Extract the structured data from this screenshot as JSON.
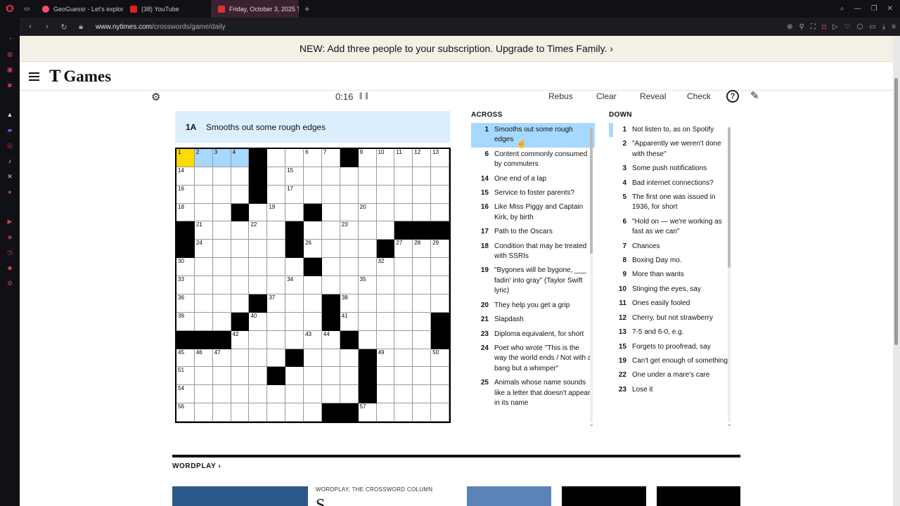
{
  "browser": {
    "tabs": [
      {
        "label": "GeoGuessr - Let's explore",
        "fav_color": "#ff4d6d"
      },
      {
        "label": "(38) YouTube",
        "fav_color": "#e62117"
      },
      {
        "label": "Friday, October 3, 2025 T",
        "fav_color": "#d33"
      }
    ],
    "url_host": "www.nytimes.com",
    "url_path": "/crosswords/game/daily"
  },
  "promo": {
    "text": "NEW: Add three people to your subscription. Upgrade to Times Family. ›"
  },
  "header": {
    "logo_t": "T",
    "logo_games": "Games"
  },
  "toolbar": {
    "timer": "0:16",
    "pause": "❚❚",
    "rebus": "Rebus",
    "clear": "Clear",
    "reveal": "Reveal",
    "check": "Check",
    "help": "?"
  },
  "current_clue": {
    "number": "1A",
    "text": "Smooths out some rough edges"
  },
  "grid": {
    "rows": [
      "....#....#.....",
      "....#..........",
      "....#..........",
      "...#...#.......",
      "#.....#.....###",
      "#.....#....#...",
      ".......#.......",
      "...............",
      "....#...#......",
      "...#....#.....#",
      "###......#....#",
      "......#...#....",
      ".....#....#....",
      "..........#....",
      "........##....."
    ],
    "numbers": [
      [
        0,
        0,
        1
      ],
      [
        0,
        1,
        2
      ],
      [
        0,
        2,
        3
      ],
      [
        0,
        3,
        4
      ],
      [
        0,
        4,
        5
      ],
      [
        0,
        7,
        6
      ],
      [
        0,
        8,
        7
      ],
      [
        0,
        9,
        8
      ],
      [
        0,
        10,
        9
      ],
      [
        0,
        11,
        10
      ],
      [
        0,
        12,
        11
      ],
      [
        0,
        13,
        12
      ],
      [
        0,
        14,
        13
      ],
      [
        1,
        0,
        14
      ],
      [
        1,
        6,
        15
      ],
      [
        2,
        0,
        16
      ],
      [
        2,
        6,
        17
      ],
      [
        3,
        0,
        18
      ],
      [
        3,
        5,
        19
      ],
      [
        3,
        10,
        20
      ],
      [
        4,
        1,
        21
      ],
      [
        4,
        4,
        22
      ],
      [
        4,
        9,
        23
      ],
      [
        5,
        1,
        24
      ],
      [
        5,
        6,
        25
      ],
      [
        5,
        7,
        26
      ],
      [
        5,
        12,
        27
      ],
      [
        5,
        13,
        28
      ],
      [
        5,
        14,
        29
      ],
      [
        6,
        0,
        30
      ],
      [
        6,
        7,
        31
      ],
      [
        6,
        11,
        32
      ],
      [
        7,
        0,
        33
      ],
      [
        7,
        6,
        34
      ],
      [
        7,
        10,
        35
      ],
      [
        8,
        0,
        36
      ],
      [
        8,
        5,
        37
      ],
      [
        8,
        9,
        38
      ],
      [
        9,
        0,
        39
      ],
      [
        9,
        4,
        40
      ],
      [
        9,
        9,
        41
      ],
      [
        10,
        3,
        42
      ],
      [
        10,
        7,
        43
      ],
      [
        10,
        8,
        44
      ],
      [
        11,
        0,
        45
      ],
      [
        11,
        1,
        46
      ],
      [
        11,
        2,
        47
      ],
      [
        11,
        6,
        48
      ],
      [
        11,
        11,
        49
      ],
      [
        11,
        14,
        50
      ],
      [
        12,
        0,
        51
      ],
      [
        12,
        5,
        52
      ],
      [
        12,
        10,
        53
      ],
      [
        13,
        0,
        54
      ],
      [
        13,
        10,
        55
      ],
      [
        14,
        0,
        56
      ],
      [
        14,
        10,
        57
      ]
    ],
    "selected": [
      0,
      0
    ],
    "highlighted": [
      [
        0,
        1
      ],
      [
        0,
        2
      ],
      [
        0,
        3
      ],
      [
        0,
        4
      ]
    ]
  },
  "across": {
    "title": "ACROSS",
    "clues": [
      {
        "n": "1",
        "t": "Smooths out some rough edges"
      },
      {
        "n": "6",
        "t": "Content commonly consumed by commuters"
      },
      {
        "n": "14",
        "t": "One end of a lap"
      },
      {
        "n": "15",
        "t": "Service to foster parents?"
      },
      {
        "n": "16",
        "t": "Like Miss Piggy and Captain Kirk, by birth"
      },
      {
        "n": "17",
        "t": "Path to the Oscars"
      },
      {
        "n": "18",
        "t": "Condition that may be treated with SSRIs"
      },
      {
        "n": "19",
        "t": "\"Bygones will be bygone, ___ fadin' into gray\" (Taylor Swift lyric)"
      },
      {
        "n": "20",
        "t": "They help you get a grip"
      },
      {
        "n": "21",
        "t": "Slapdash"
      },
      {
        "n": "23",
        "t": "Diploma equivalent, for short"
      },
      {
        "n": "24",
        "t": "Poet who wrote \"This is the way the world ends / Not with a bang but a whimper\""
      },
      {
        "n": "25",
        "t": "Animals whose name sounds like a letter that doesn't appear in its name"
      }
    ]
  },
  "down": {
    "title": "DOWN",
    "clues": [
      {
        "n": "1",
        "t": "Not listen to, as on Spotify"
      },
      {
        "n": "2",
        "t": "\"Apparently we weren't done with these\""
      },
      {
        "n": "3",
        "t": "Some push notifications"
      },
      {
        "n": "4",
        "t": "Bad internet connections?"
      },
      {
        "n": "5",
        "t": "The first one was issued in 1936, for short"
      },
      {
        "n": "6",
        "t": "\"Hold on — we're working as fast as we can\""
      },
      {
        "n": "7",
        "t": "Chances"
      },
      {
        "n": "8",
        "t": "Boxing Day mo."
      },
      {
        "n": "9",
        "t": "More than wants"
      },
      {
        "n": "10",
        "t": "Stinging the eyes, say"
      },
      {
        "n": "11",
        "t": "Ones easily fooled"
      },
      {
        "n": "12",
        "t": "Cherry, but not strawberry"
      },
      {
        "n": "13",
        "t": "7-5 and 6-0, e.g."
      },
      {
        "n": "15",
        "t": "Forgets to proofread, say"
      },
      {
        "n": "19",
        "t": "Can't get enough of something"
      },
      {
        "n": "22",
        "t": "One under a mare's care"
      },
      {
        "n": "23",
        "t": "Lose it"
      }
    ]
  },
  "wordplay": {
    "label": "WORDPLAY ›",
    "column_label": "WORDPLAY, THE CROSSWORD COLUMN",
    "column_title": "S"
  }
}
